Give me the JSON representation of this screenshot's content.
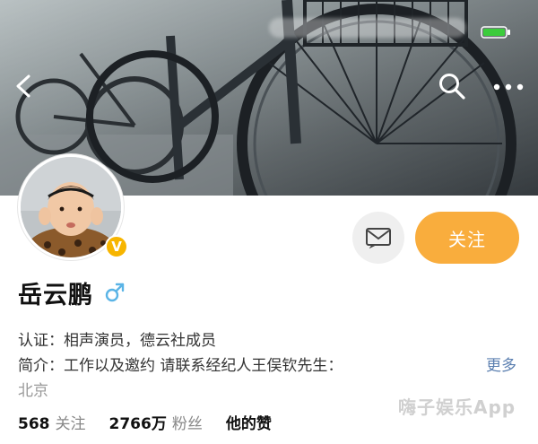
{
  "profile": {
    "name": "岳云鹏",
    "gender": "male",
    "gender_symbol": "♂",
    "verified": true,
    "verify_badge": "V",
    "cert_label": "认证：",
    "cert_text": "相声演员，德云社成员",
    "intro_label": "简介：",
    "intro_text": "工作以及邀约 请联系经纪人王俣钦先生：",
    "more_label": "更多",
    "location": "北京"
  },
  "actions": {
    "follow_label": "关注",
    "message_icon": "message-icon"
  },
  "stats": {
    "following_count": "568",
    "following_label": "关注",
    "followers_count": "2766万",
    "followers_label": "粉丝",
    "likes_label": "他的赞"
  },
  "header": {
    "icons": [
      "back-icon",
      "search-icon",
      "more-icon",
      "battery-icon"
    ]
  },
  "watermark": "嗨子娱乐App",
  "colors": {
    "follow_button": "#f9ad3d",
    "verify_badge": "#f7b500",
    "gender_icon": "#5ab4e6",
    "more_link": "#5b7fb0",
    "battery": "#3ccc3c"
  }
}
